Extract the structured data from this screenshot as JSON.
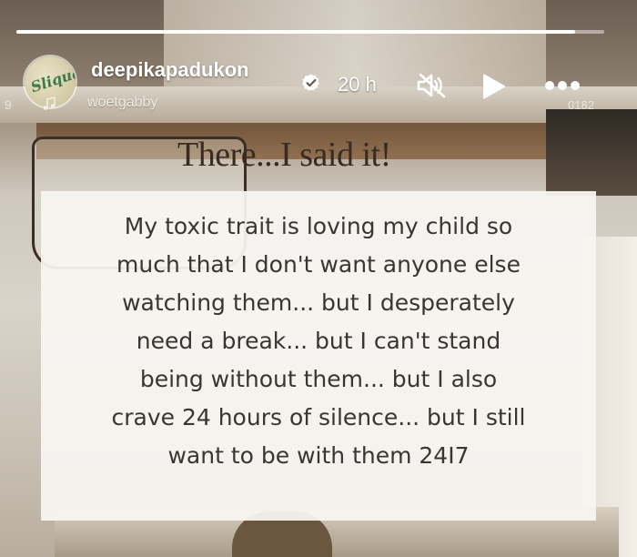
{
  "story": {
    "progress": 0.95,
    "username": "deepikapadukon",
    "verified": true,
    "time_ago": "20 h",
    "muted": true,
    "avatar_text": "Sliqua",
    "audio": {
      "left_fragment": "9",
      "track": "wo",
      "track_rest": "etgabby",
      "right_fragment": "0182"
    },
    "headline": "There...I said it!",
    "body_text": "My toxic trait is loving my child so\nmuch that I don't want anyone else\nwatching them... but I desperately\nneed a break... but I can't stand\nbeing without them... but I also\ncrave 24 hours of silence... but I still\nwant to be with them 24I7"
  },
  "icons": {
    "verified": "verified-badge-icon",
    "mute": "speaker-muted-icon",
    "play": "play-icon",
    "more": "more-options-icon",
    "audio": "music-note-icon"
  },
  "colors": {
    "overlay_text": "#ffffff",
    "headline_text": "#3a2b22",
    "card_background": "#f7f5f1",
    "body_text": "#3a3531"
  }
}
